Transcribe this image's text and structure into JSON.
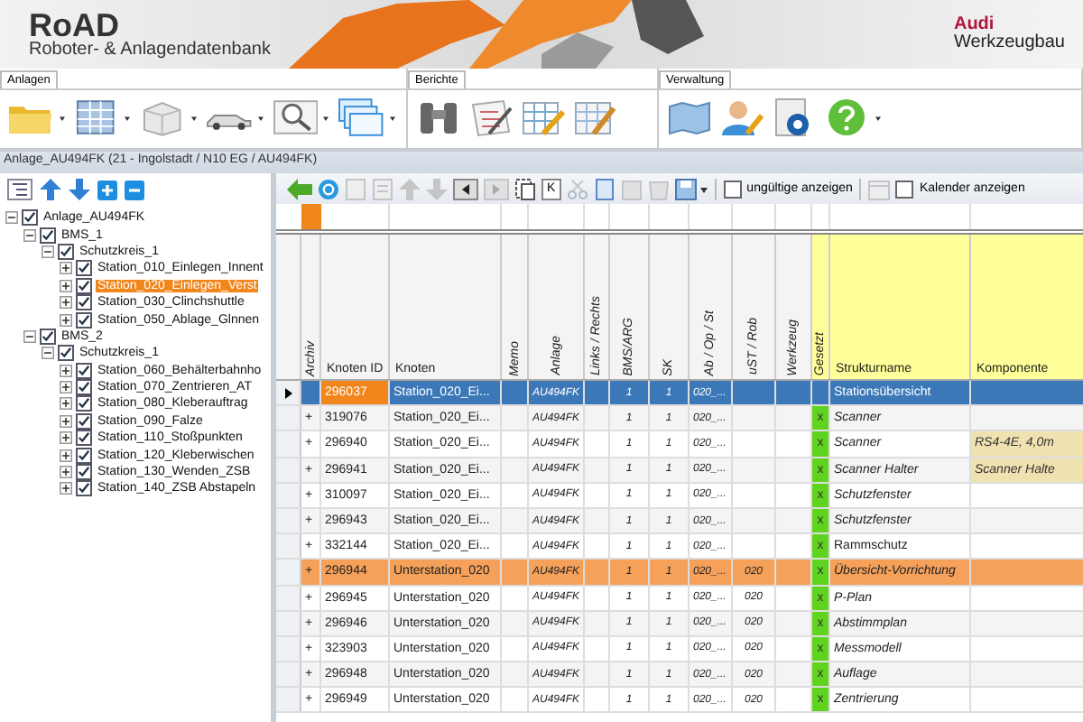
{
  "header": {
    "logo": "RoAD",
    "subtitle": "Roboter- & Anlagendatenbank",
    "brand": "Audi",
    "brand_sub": "Werkzeugbau"
  },
  "ribbon": {
    "groups": [
      {
        "label": "Anlagen"
      },
      {
        "label": "Berichte"
      },
      {
        "label": "Verwaltung"
      }
    ]
  },
  "document_title": "Anlage_AU494FK (21 - Ingolstadt / N10 EG / AU494FK)",
  "tree": [
    {
      "label": "Anlage_AU494FK",
      "checked": true,
      "expanded": true,
      "selected": false,
      "children": [
        {
          "label": "BMS_1",
          "checked": true,
          "expanded": true,
          "selected": false,
          "children": [
            {
              "label": "Schutzkreis_1",
              "checked": true,
              "expanded": true,
              "selected": false,
              "children": [
                {
                  "label": "Station_010_Einlegen_Innent",
                  "checked": true,
                  "expanded": false,
                  "selected": false
                },
                {
                  "label": "Station_020_Einlegen_Verst",
                  "checked": true,
                  "expanded": false,
                  "selected": true
                },
                {
                  "label": "Station_030_Clinchshuttle",
                  "checked": true,
                  "expanded": false,
                  "selected": false
                },
                {
                  "label": "Station_050_Ablage_Glnnen",
                  "checked": true,
                  "expanded": false,
                  "selected": false
                }
              ]
            }
          ]
        },
        {
          "label": "BMS_2",
          "checked": true,
          "expanded": true,
          "selected": false,
          "children": [
            {
              "label": "Schutzkreis_1",
              "checked": true,
              "expanded": true,
              "selected": false,
              "children": [
                {
                  "label": "Station_060_Behälterbahnho",
                  "checked": true,
                  "expanded": false,
                  "selected": false
                },
                {
                  "label": "Station_070_Zentrieren_AT",
                  "checked": true,
                  "expanded": false,
                  "selected": false
                },
                {
                  "label": "Station_080_Kleberauftrag",
                  "checked": true,
                  "expanded": false,
                  "selected": false
                },
                {
                  "label": "Station_090_Falze",
                  "checked": true,
                  "expanded": false,
                  "selected": false
                },
                {
                  "label": "Station_110_Stoßpunkten",
                  "checked": true,
                  "expanded": false,
                  "selected": false
                },
                {
                  "label": "Station_120_Kleberwischen",
                  "checked": true,
                  "expanded": false,
                  "selected": false
                },
                {
                  "label": "Station_130_Wenden_ZSB",
                  "checked": true,
                  "expanded": false,
                  "selected": false
                },
                {
                  "label": "Station_140_ZSB Abstapeln",
                  "checked": true,
                  "expanded": false,
                  "selected": false
                }
              ]
            }
          ]
        }
      ]
    }
  ],
  "toolbar": {
    "k_button": "K",
    "checkboxes": [
      {
        "label": "ungültige anzeigen",
        "checked": false
      },
      {
        "label": "Kalender anzeigen",
        "checked": false
      }
    ]
  },
  "table": {
    "columns": [
      {
        "label": "Archiv",
        "kind": "vertical",
        "highlight": false
      },
      {
        "label": "Knoten ID",
        "kind": "horizontal",
        "highlight": false
      },
      {
        "label": "Knoten",
        "kind": "horizontal",
        "highlight": false
      },
      {
        "label": "Memo",
        "kind": "vertical",
        "highlight": false
      },
      {
        "label": "Anlage",
        "kind": "vertical",
        "highlight": false
      },
      {
        "label": "Links / Rechts",
        "kind": "vertical",
        "highlight": false
      },
      {
        "label": "BMS/ARG",
        "kind": "vertical",
        "highlight": false
      },
      {
        "label": "SK",
        "kind": "vertical",
        "highlight": false
      },
      {
        "label": "Ab / Op / St",
        "kind": "vertical",
        "highlight": false
      },
      {
        "label": "uST / Rob",
        "kind": "vertical",
        "highlight": false
      },
      {
        "label": "Werkzeug",
        "kind": "vertical",
        "highlight": false
      },
      {
        "label": "Gesetzt",
        "kind": "vertical",
        "highlight": true
      },
      {
        "label": "Strukturname",
        "kind": "horizontal",
        "highlight": true
      },
      {
        "label": "Komponente",
        "kind": "horizontal",
        "highlight": true
      }
    ],
    "rows": [
      {
        "selected": true,
        "highlighted": false,
        "id": "296037",
        "knoten": "Station_020_Ei...",
        "anlage": "AU494FK",
        "bms": "1",
        "sk": "1",
        "ab": "020_...",
        "gesetzt": false,
        "struktur": "Stationsübersicht",
        "italic": false
      },
      {
        "selected": false,
        "highlighted": false,
        "archiv": "+",
        "id": "319076",
        "knoten": "Station_020_Ei...",
        "anlage": "AU494FK",
        "bms": "1",
        "sk": "1",
        "ab": "020_...",
        "gesetzt": true,
        "gesetzt_mark": "x",
        "struktur": "Scanner",
        "italic": true
      },
      {
        "selected": false,
        "highlighted": false,
        "archiv": "+",
        "id": "296940",
        "knoten": "Station_020_Ei...",
        "anlage": "AU494FK",
        "bms": "1",
        "sk": "1",
        "ab": "020_...",
        "gesetzt": true,
        "gesetzt_mark": "x",
        "struktur": "Scanner",
        "italic": true,
        "komponente": "RS4-4E, 4,0m"
      },
      {
        "selected": false,
        "highlighted": false,
        "archiv": "+",
        "id": "296941",
        "knoten": "Station_020_Ei...",
        "anlage": "AU494FK",
        "bms": "1",
        "sk": "1",
        "ab": "020_...",
        "gesetzt": true,
        "gesetzt_mark": "x",
        "struktur": "Scanner Halter",
        "italic": true,
        "komponente": "Scanner Halte"
      },
      {
        "selected": false,
        "highlighted": false,
        "archiv": "+",
        "id": "310097",
        "knoten": "Station_020_Ei...",
        "anlage": "AU494FK",
        "bms": "1",
        "sk": "1",
        "ab": "020_...",
        "gesetzt": true,
        "gesetzt_mark": "x",
        "struktur": "Schutzfenster",
        "italic": true
      },
      {
        "selected": false,
        "highlighted": false,
        "archiv": "+",
        "id": "296943",
        "knoten": "Station_020_Ei...",
        "anlage": "AU494FK",
        "bms": "1",
        "sk": "1",
        "ab": "020_...",
        "gesetzt": true,
        "gesetzt_mark": "x",
        "struktur": "Schutzfenster",
        "italic": true
      },
      {
        "selected": false,
        "highlighted": false,
        "archiv": "+",
        "id": "332144",
        "knoten": "Station_020_Ei...",
        "anlage": "AU494FK",
        "bms": "1",
        "sk": "1",
        "ab": "020_...",
        "gesetzt": true,
        "gesetzt_mark": "x",
        "struktur": "Rammschutz",
        "italic": false
      },
      {
        "selected": false,
        "highlighted": true,
        "archiv": "+",
        "id": "296944",
        "knoten": "Unterstation_020",
        "anlage": "AU494FK",
        "bms": "1",
        "sk": "1",
        "ab": "020_...",
        "ust": "020",
        "gesetzt": true,
        "gesetzt_mark": "x",
        "struktur": "Übersicht-Vorrichtung",
        "italic": true
      },
      {
        "selected": false,
        "highlighted": false,
        "archiv": "+",
        "id": "296945",
        "knoten": "Unterstation_020",
        "anlage": "AU494FK",
        "bms": "1",
        "sk": "1",
        "ab": "020_...",
        "ust": "020",
        "gesetzt": true,
        "gesetzt_mark": "x",
        "struktur": "P-Plan",
        "italic": true
      },
      {
        "selected": false,
        "highlighted": false,
        "archiv": "+",
        "id": "296946",
        "knoten": "Unterstation_020",
        "anlage": "AU494FK",
        "bms": "1",
        "sk": "1",
        "ab": "020_...",
        "ust": "020",
        "gesetzt": true,
        "gesetzt_mark": "x",
        "struktur": "Abstimmplan",
        "italic": true
      },
      {
        "selected": false,
        "highlighted": false,
        "archiv": "+",
        "id": "323903",
        "knoten": "Unterstation_020",
        "anlage": "AU494FK",
        "bms": "1",
        "sk": "1",
        "ab": "020_...",
        "ust": "020",
        "gesetzt": true,
        "gesetzt_mark": "x",
        "struktur": "Messmodell",
        "italic": true
      },
      {
        "selected": false,
        "highlighted": false,
        "archiv": "+",
        "id": "296948",
        "knoten": "Unterstation_020",
        "anlage": "AU494FK",
        "bms": "1",
        "sk": "1",
        "ab": "020_...",
        "ust": "020",
        "gesetzt": true,
        "gesetzt_mark": "x",
        "struktur": "Auflage",
        "italic": true
      },
      {
        "selected": false,
        "highlighted": false,
        "archiv": "+",
        "id": "296949",
        "knoten": "Unterstation_020",
        "anlage": "AU494FK",
        "bms": "1",
        "sk": "1",
        "ab": "020_...",
        "ust": "020",
        "gesetzt": true,
        "gesetzt_mark": "x",
        "struktur": "Zentrierung",
        "italic": true
      }
    ]
  }
}
